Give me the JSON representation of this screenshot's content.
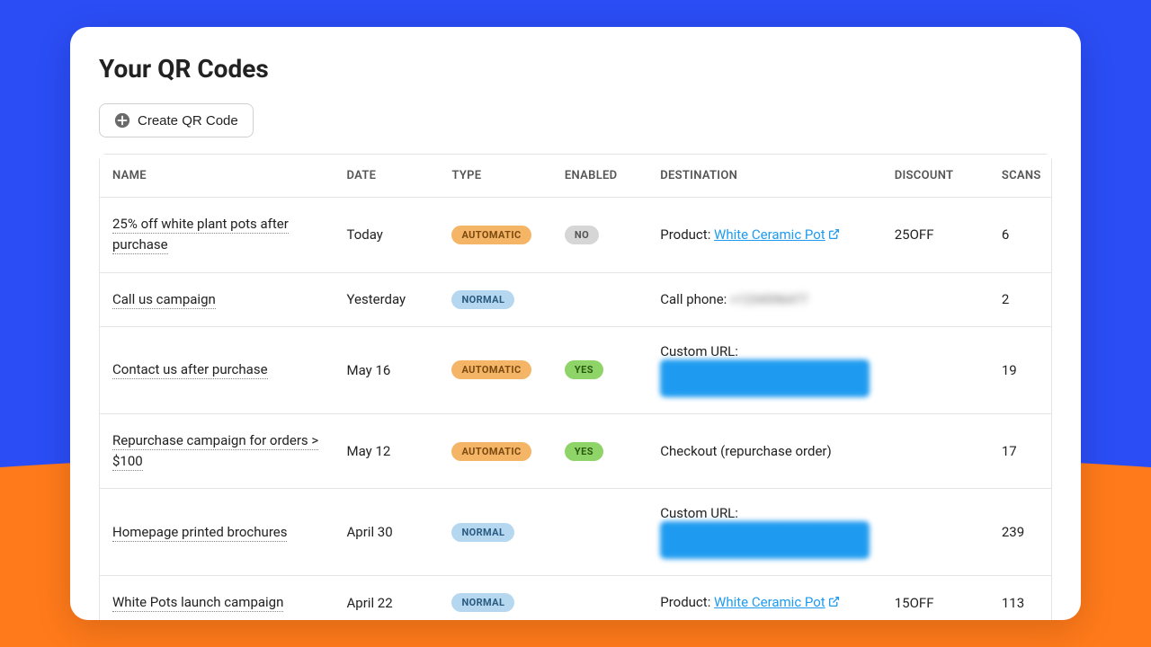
{
  "page": {
    "title": "Your QR Codes"
  },
  "actions": {
    "createLabel": "Create QR Code"
  },
  "columns": {
    "name": "NAME",
    "date": "DATE",
    "type": "TYPE",
    "enabled": "ENABLED",
    "destination": "DESTINATION",
    "discount": "DISCOUNT",
    "scans": "SCANS"
  },
  "pills": {
    "automatic": "AUTOMATIC",
    "normal": "NORMAL",
    "yes": "YES",
    "no": "NO"
  },
  "rows": [
    {
      "name": "25% off white plant pots after purchase",
      "date": "Today",
      "type": "automatic",
      "enabled": "no",
      "destination": {
        "kind": "product",
        "prefix": "Product: ",
        "label": "White Ceramic Pot"
      },
      "discount": "25OFF",
      "scans": "6"
    },
    {
      "name": "Call us campaign",
      "date": "Yesterday",
      "type": "normal",
      "enabled": "",
      "destination": {
        "kind": "phone",
        "prefix": "Call phone: ",
        "label": "+1234596477"
      },
      "discount": "",
      "scans": "2"
    },
    {
      "name": "Contact us after purchase",
      "date": "May 16",
      "type": "automatic",
      "enabled": "yes",
      "destination": {
        "kind": "customurl",
        "prefix": "Custom URL:",
        "label": "https://example.com/contact-us-after-purchase"
      },
      "discount": "",
      "scans": "19"
    },
    {
      "name": "Repurchase campaign for orders > $100",
      "date": "May 12",
      "type": "automatic",
      "enabled": "yes",
      "destination": {
        "kind": "text",
        "prefix": "",
        "label": "Checkout (repurchase order)"
      },
      "discount": "",
      "scans": "17"
    },
    {
      "name": "Homepage printed brochures",
      "date": "April 30",
      "type": "normal",
      "enabled": "",
      "destination": {
        "kind": "customurl",
        "prefix": "Custom URL:",
        "label": "https://example.com/homepage-printed-brochures"
      },
      "discount": "",
      "scans": "239"
    },
    {
      "name": "White Pots launch campaign",
      "date": "April 22",
      "type": "normal",
      "enabled": "",
      "destination": {
        "kind": "product",
        "prefix": "Product: ",
        "label": "White Ceramic Pot"
      },
      "discount": "15OFF",
      "scans": "113"
    }
  ]
}
